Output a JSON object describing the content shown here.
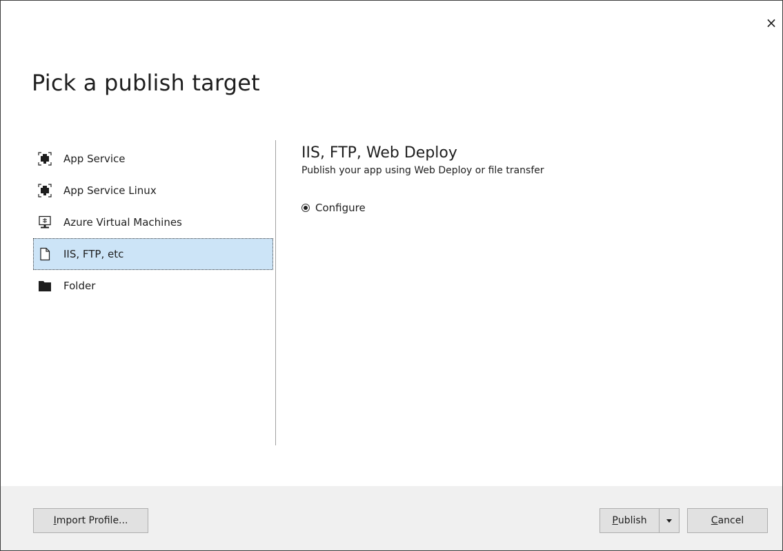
{
  "dialog": {
    "title": "Pick a publish target",
    "close_label": "×"
  },
  "targets": [
    {
      "label": "App Service",
      "icon": "app-service-icon",
      "selected": false
    },
    {
      "label": "App Service Linux",
      "icon": "app-service-linux-icon",
      "selected": false
    },
    {
      "label": "Azure Virtual Machines",
      "icon": "virtual-machine-icon",
      "selected": false
    },
    {
      "label": "IIS, FTP, etc",
      "icon": "file-icon",
      "selected": true
    },
    {
      "label": "Folder",
      "icon": "folder-icon",
      "selected": false
    }
  ],
  "detail": {
    "title": "IIS, FTP, Web Deploy",
    "subtitle": "Publish your app using Web Deploy or file transfer",
    "options": [
      {
        "label": "Configure",
        "checked": true
      }
    ]
  },
  "footer": {
    "import_mnemonic": "I",
    "import_rest": "mport Profile...",
    "publish_mnemonic": "P",
    "publish_rest": "ublish",
    "cancel_mnemonic": "C",
    "cancel_rest": "ancel"
  },
  "colors": {
    "selection_bg": "#cce4f7",
    "footer_bg": "#f0f0f0",
    "button_bg": "#e1e1e1",
    "divider": "#a0a0a0"
  }
}
